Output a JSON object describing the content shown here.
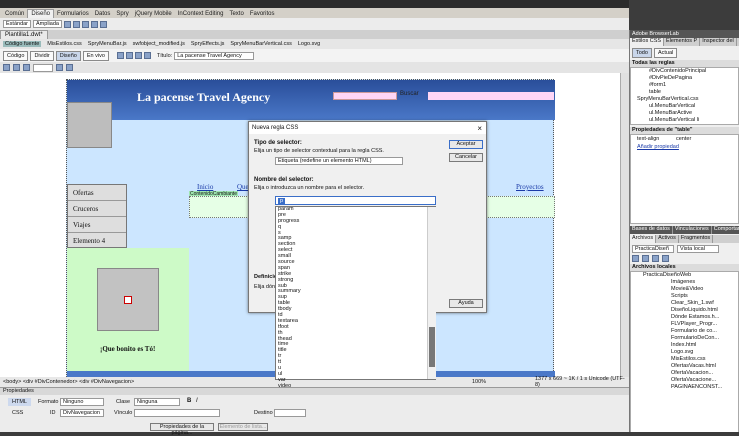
{
  "top_tabs": [
    "Común",
    "Diseño",
    "Formularios",
    "Datos",
    "Spry",
    "jQuery Mobile",
    "InContext Editing",
    "Texto",
    "Favoritos"
  ],
  "doc_tab": "Plantilla1.dwt*",
  "related_files": [
    "Código fuente",
    "MisEstilos.css",
    "SpryMenuBar.js",
    "swfobject_modified.js",
    "SpryEffects.js",
    "SpryMenuBarVertical.css",
    "Logo.svg"
  ],
  "view_buttons": [
    "Código",
    "Dividir",
    "Diseño",
    "En vivo"
  ],
  "title_label": "Título:",
  "title_value": "La pacense Travel Agency",
  "page": {
    "heading": "La pacense Travel Agency",
    "search_button": "Buscar",
    "menu": [
      "Ofertas",
      "Cruceros",
      "Viajes",
      "Elemento 4"
    ],
    "hnav": [
      "Inicio",
      "Que",
      "Proyectos"
    ],
    "editable_region": "ContenidoCambiante",
    "footer_text": "¡Que bonito es Tó!"
  },
  "dialog": {
    "title": "Nueva regla CSS",
    "selector_type_title": "Tipo de selector:",
    "selector_type_desc": "Elija un tipo de selector contextual para la regla CSS.",
    "selector_type_value": "Etiqueta (redefine un elemento HTML)",
    "selector_name_title": "Nombre del selector:",
    "selector_name_desc": "Elija o introduzca un nombre para el selector.",
    "selector_value": "p",
    "rule_def_label": "Definición",
    "rule_def_desc": "Elija dónde",
    "ok_label": "Aceptar",
    "cancel_label": "Cancelar",
    "help_label": "Ayuda",
    "tags": [
      "param",
      "pre",
      "progress",
      "q",
      "s",
      "samp",
      "section",
      "select",
      "small",
      "source",
      "span",
      "strike",
      "strong",
      "sub",
      "summary",
      "sup",
      "table",
      "tbody",
      "td",
      "textarea",
      "tfoot",
      "th",
      "thead",
      "time",
      "title",
      "tr",
      "tt",
      "u",
      "ul",
      "var",
      "video"
    ]
  },
  "status": {
    "breadcrumb": "<body> <div #DivContenedor> <div #DivNavegacion>",
    "zoom": "100%",
    "dims": "1377 x 669 ~ 1K / 1 s  Unicode (UTF-8)"
  },
  "properties": {
    "header": "Propiedades",
    "html_label": "HTML",
    "css_label": "CSS",
    "format_label": "Formato",
    "format_value": "Ninguno",
    "class_label": "Clase",
    "class_value": "Ninguna",
    "id_label": "ID",
    "id_value": "DivNavegacion",
    "link_label": "Vínculo",
    "target_label": "Destino",
    "page_props_button": "Propiedades de la página...",
    "list_item_button": "Elemento de lista..."
  },
  "right_panel": {
    "header": "Adobe BrowserLab",
    "tabs": [
      "Estilos CSS",
      "Elementos P",
      "Inspector del"
    ],
    "mode_all": "Todo",
    "mode_current": "Actual",
    "all_rules_title": "Todas las reglas",
    "rules": [
      "#DivContenidoPrincipal",
      "#DivPieDePagina",
      "#form1",
      "table",
      "SpryMenuBarVertical.css",
      "ul.MenuBarVertical",
      "ul.MenuBarActive",
      "ul.MenuBarVertical li"
    ],
    "props_title": "Propiedades de \"table\"",
    "prop_name": "text-align",
    "prop_value": "center",
    "add_prop": "Añadir propiedad",
    "panel2_tabs": [
      "Bases de datos",
      "Vinculaciones",
      "Comportam"
    ],
    "files_tabs": [
      "Archivos",
      "Activos",
      "Fragmentos"
    ],
    "site_select": "PracticaDiseñ",
    "view_select": "Vista local",
    "local_files_title": "Archivos locales",
    "files": [
      "PracticaDiseñoWeb",
      "Imágenes",
      "Movie&Video",
      "Scripts",
      "Clear_Skin_1.swf",
      "DiseñoLiquido.html",
      "Dónde Estamos.h...",
      "FLVPlayer_Progr...",
      "Formulario de co...",
      "FormularioDeCon...",
      "Index.html",
      "Logo.svg",
      "MisEstilos.css",
      "OfertasVacas.html",
      "OfertaVacacion...",
      "OfertaVacacione...",
      "PAGINAENCONST..."
    ]
  }
}
